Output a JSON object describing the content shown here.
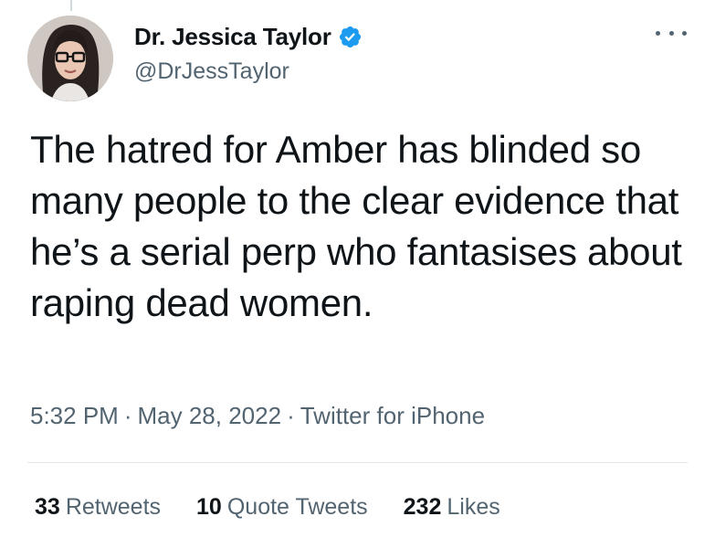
{
  "author": {
    "display_name": "Dr. Jessica Taylor",
    "handle": "@DrJessTaylor",
    "verified": true,
    "verified_icon": "verified-badge-icon"
  },
  "menu": {
    "icon": "more-horizontal-icon"
  },
  "tweet": {
    "text": "The hatred for Amber has blinded so many people to the clear evidence that he’s a serial perp who fantasises about raping dead women.",
    "time": "5:32 PM",
    "date": "May 28, 2022",
    "source": "Twitter for iPhone",
    "separator": "·"
  },
  "stats": {
    "retweets_count": "33",
    "retweets_label": "Retweets",
    "quotes_count": "10",
    "quotes_label": "Quote Tweets",
    "likes_count": "232",
    "likes_label": "Likes"
  },
  "colors": {
    "text_primary": "#0f1419",
    "text_secondary": "#536471",
    "verified_blue": "#1d9bf0",
    "divider": "#e1e8ed"
  }
}
